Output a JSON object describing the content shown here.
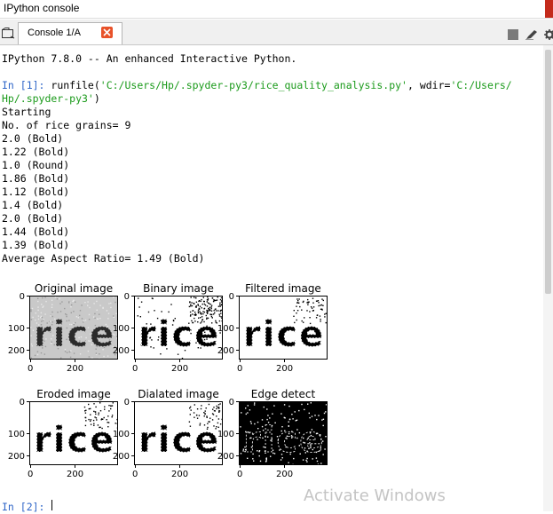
{
  "window": {
    "title": "IPython console"
  },
  "tabs": [
    {
      "label": "Console 1/A"
    }
  ],
  "console": {
    "banner": "IPython 7.8.0 -- An enhanced Interactive Python.",
    "prompt1": "In [1]:",
    "cmd_prefix": " runfile(",
    "cmd_arg1": "'C:/Users/Hp/.spyder-py3/rice_quality_analysis.py'",
    "cmd_sep": ", wdir=",
    "cmd_arg2_part1": "'C:/Users/",
    "cmd_arg2_part2": "Hp/.spyder-py3'",
    "cmd_close": ")",
    "output": [
      "Starting",
      "No. of rice grains= 9",
      "2.0 (Bold)",
      "1.22 (Bold)",
      "1.0 (Round)",
      "1.86 (Bold)",
      "1.12 (Bold)",
      "1.4 (Bold)",
      "2.0 (Bold)",
      "1.44 (Bold)",
      "1.39 (Bold)",
      "Average Aspect Ratio= 1.49 (Bold)"
    ],
    "prompt2": "In [2]:"
  },
  "figures": [
    {
      "title": "Original image",
      "style": "original"
    },
    {
      "title": "Binary image",
      "style": "binary"
    },
    {
      "title": "Filtered image",
      "style": "filtered"
    },
    {
      "title": "Eroded image",
      "style": "eroded"
    },
    {
      "title": "Dialated image",
      "style": "dilated"
    },
    {
      "title": "Edge detect",
      "style": "edge"
    }
  ],
  "axis_ticks": {
    "y": [
      "0",
      "100",
      "200"
    ],
    "x": [
      "0",
      "200"
    ]
  },
  "image_word": "rice",
  "watermark": "Activate Windows",
  "icons": [
    "browse-tabs-icon",
    "close-tab-icon",
    "stop-icon",
    "edit-icon",
    "gear-icon"
  ]
}
